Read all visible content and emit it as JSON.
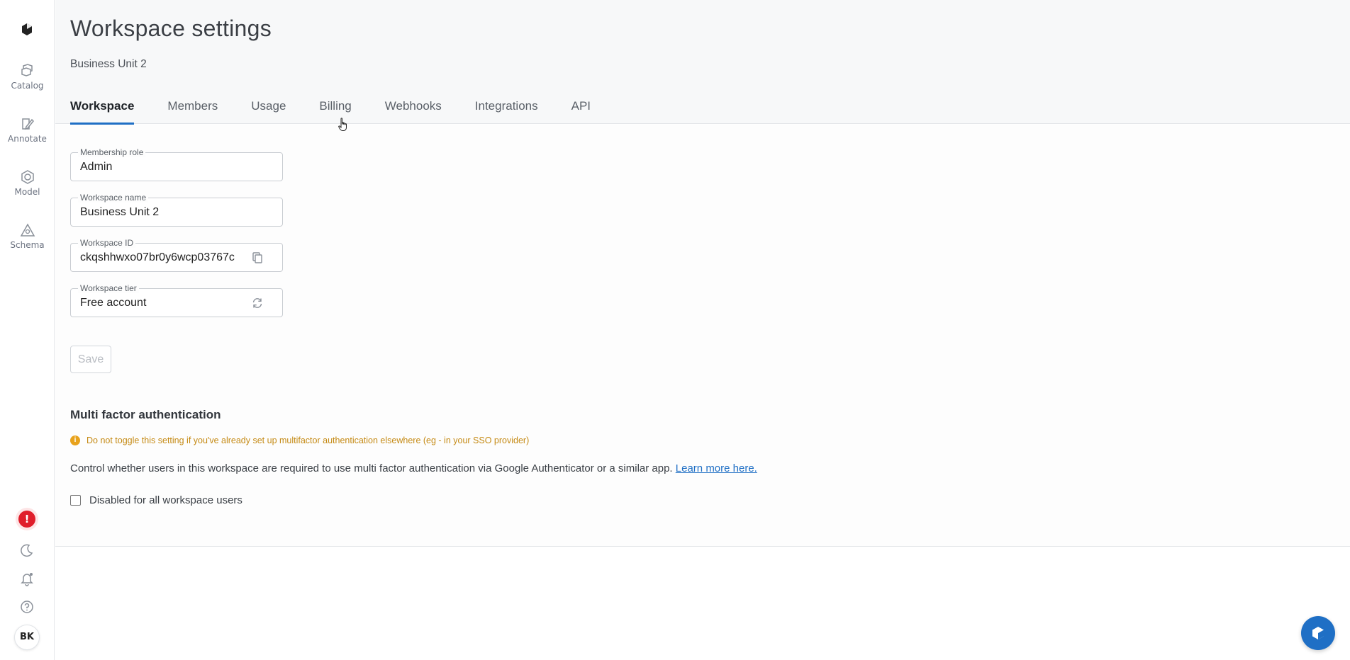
{
  "sidebar": {
    "items": [
      {
        "label": "Catalog",
        "icon": "catalog-icon"
      },
      {
        "label": "Annotate",
        "icon": "annotate-icon"
      },
      {
        "label": "Model",
        "icon": "model-icon"
      },
      {
        "label": "Schema",
        "icon": "schema-icon"
      }
    ],
    "alert_badge": "!",
    "avatar_initials": "BK"
  },
  "header": {
    "title": "Workspace settings",
    "subtitle": "Business Unit 2",
    "tabs": [
      {
        "label": "Workspace",
        "active": true
      },
      {
        "label": "Members",
        "active": false
      },
      {
        "label": "Usage",
        "active": false
      },
      {
        "label": "Billing",
        "active": false
      },
      {
        "label": "Webhooks",
        "active": false
      },
      {
        "label": "Integrations",
        "active": false
      },
      {
        "label": "API",
        "active": false
      }
    ]
  },
  "form": {
    "membership_role": {
      "label": "Membership role",
      "value": "Admin"
    },
    "workspace_name": {
      "label": "Workspace name",
      "value": "Business Unit 2"
    },
    "workspace_id": {
      "label": "Workspace ID",
      "value": "ckqshhwxo07br0y6wcp03767c",
      "icon": "copy-icon"
    },
    "workspace_tier": {
      "label": "Workspace tier",
      "value": "Free account",
      "icon": "refresh-icon"
    },
    "save_label": "Save"
  },
  "mfa": {
    "title": "Multi factor authentication",
    "warning": "Do not toggle this setting if you've already set up multifactor authentication elsewhere (eg - in your SSO provider)",
    "description": "Control whether users in this workspace are required to use multi factor authentication via Google Authenticator or a similar app.",
    "learn_more": "Learn more here.",
    "checkbox_label": "Disabled for all workspace users",
    "checked": false
  },
  "colors": {
    "accent": "#1f6fc5",
    "warning": "#c58a14",
    "alert": "#e01e2b"
  }
}
